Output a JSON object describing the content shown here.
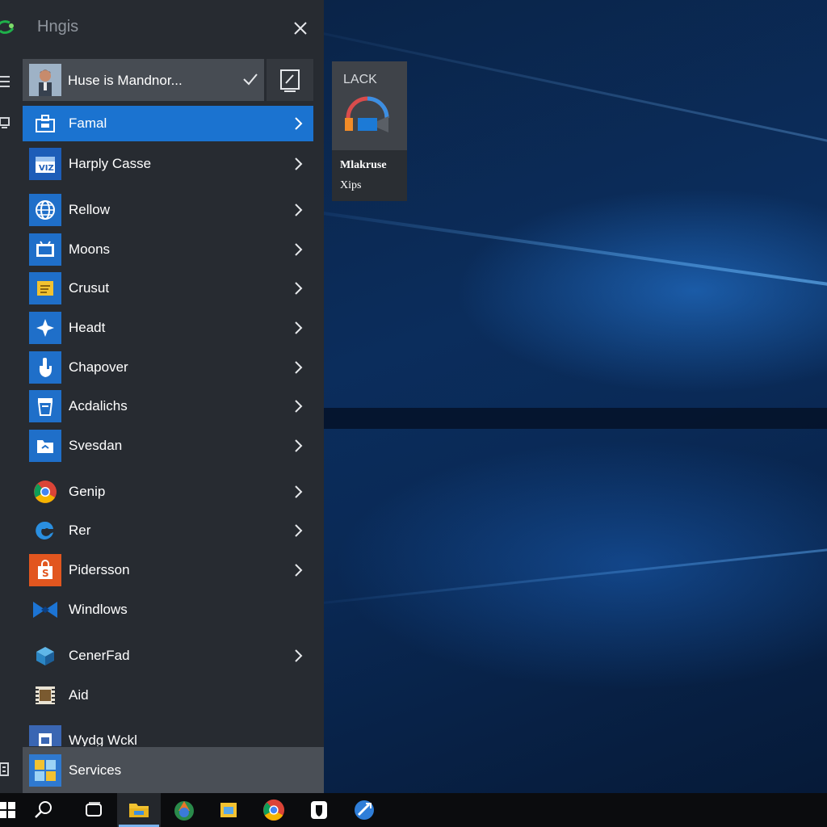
{
  "header": {
    "title": "Hngis",
    "close_icon": "close-icon",
    "logo_icon": "logo-icon"
  },
  "user": {
    "name": "Huse is Mandnor...",
    "confirm_icon": "check-icon",
    "edit_icon": "edit-icon"
  },
  "menu": {
    "items": [
      {
        "label": "Famal",
        "icon": "briefcase-icon",
        "has_submenu": true,
        "selected": true
      },
      {
        "label": "Harply Casse",
        "icon": "calendar-icon",
        "has_submenu": true
      },
      {
        "label": "Rellow",
        "icon": "globe-icon",
        "has_submenu": true
      },
      {
        "label": "Moons",
        "icon": "monitor-icon",
        "has_submenu": true
      },
      {
        "label": "Crusut",
        "icon": "folder-icon",
        "has_submenu": true
      },
      {
        "label": "Headt",
        "icon": "star-icon",
        "has_submenu": true
      },
      {
        "label": "Chapover",
        "icon": "hand-icon",
        "has_submenu": true
      },
      {
        "label": "Acdalichs",
        "icon": "cup-icon",
        "has_submenu": true
      },
      {
        "label": "Svesdan",
        "icon": "folder-icon",
        "has_submenu": true
      },
      {
        "label": "Genip",
        "icon": "chrome-icon",
        "has_submenu": true
      },
      {
        "label": "Rer",
        "icon": "edge-icon",
        "has_submenu": true
      },
      {
        "label": "Pidersson",
        "icon": "shopping-bag-icon",
        "has_submenu": true
      },
      {
        "label": "Windlows",
        "icon": "visual-studio-icon",
        "has_submenu": false
      },
      {
        "label": "CenerFad",
        "icon": "cube-icon",
        "has_submenu": true
      },
      {
        "label": "Aid",
        "icon": "film-icon",
        "has_submenu": false
      },
      {
        "label": "Wydg Wckl",
        "icon": "document-icon",
        "has_submenu": false
      }
    ],
    "footer": {
      "label": "Services",
      "icon": "services-icon"
    }
  },
  "tile": {
    "title": "LACK",
    "line1": "Mlakruse",
    "line2": "Xips",
    "icon": "camera-icon"
  },
  "taskbar": {
    "items": [
      "windows-start-icon",
      "search-icon",
      "task-view-icon",
      "file-explorer-icon",
      "media-player-icon",
      "folder-icon",
      "chrome-icon",
      "security-shield-icon",
      "edge-icon"
    ]
  },
  "colors": {
    "accent": "#1b73d0",
    "panel": "#272b31",
    "taskbar": "#0b0c0e",
    "wallpaper": "#0b2d5c"
  }
}
